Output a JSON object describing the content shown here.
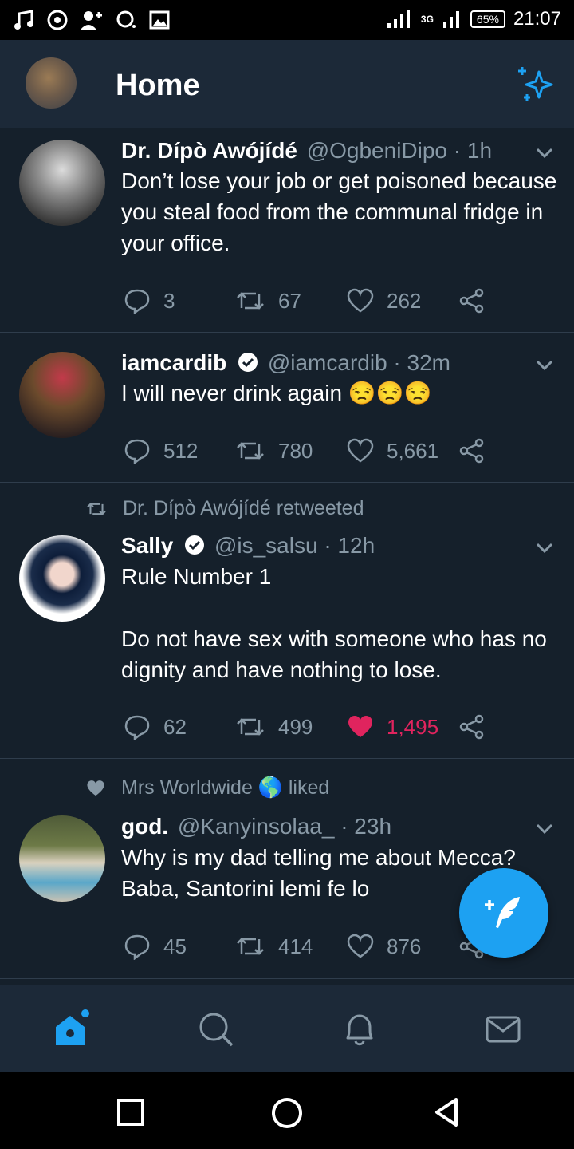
{
  "status_bar": {
    "battery": "65%",
    "time": "21:07",
    "network": "3G"
  },
  "header": {
    "title": "Home"
  },
  "tweets": [
    {
      "context": "",
      "name": "Dr. Dípò Awójídé",
      "handle": "@OgbeniDipo · 1h",
      "verified": false,
      "text": "Don’t lose your job or get poisoned because you steal food from the communal fridge in your office.",
      "replies": "3",
      "retweets": "67",
      "likes": "262",
      "liked": false
    },
    {
      "context": "",
      "name": "iamcardib",
      "handle": "@iamcardib · 32m",
      "verified": true,
      "text": "I will never drink again 😒😒😒",
      "replies": "512",
      "retweets": "780",
      "likes": "5,661",
      "liked": false
    },
    {
      "context": "Dr. Dípò Awójídé retweeted",
      "name": "Sally",
      "handle": "@is_salsu · 12h",
      "verified": true,
      "text": "Rule Number 1\n\nDo not have sex with someone who has no dignity and have nothing to lose.",
      "replies": "62",
      "retweets": "499",
      "likes": "1,495",
      "liked": true
    },
    {
      "context": "Mrs Worldwide 🌎 liked",
      "name": "god.",
      "handle": "@Kanyinsolaa_ · 23h",
      "verified": false,
      "text": "Why is my dad telling me about Mecca? Baba, Santorini lemi fe lo",
      "replies": "45",
      "retweets": "414",
      "likes": "876",
      "liked": false
    }
  ],
  "colors": {
    "background": "#15202b",
    "bar": "#1c2938",
    "accent": "#1da1f2",
    "muted": "#8899a6",
    "like": "#e0245e"
  }
}
